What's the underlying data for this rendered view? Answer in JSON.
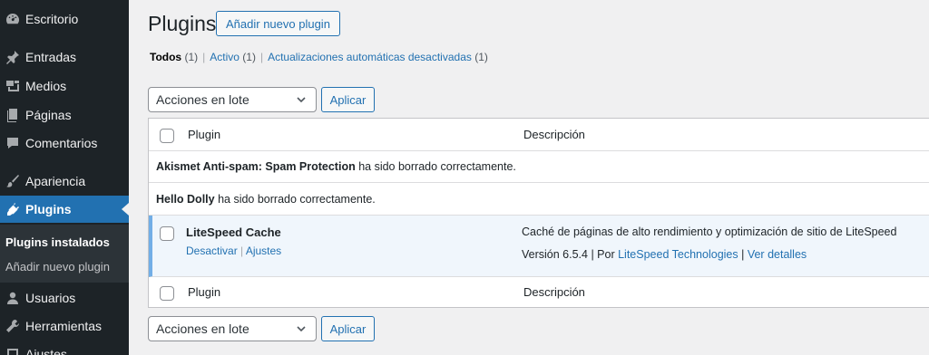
{
  "sidebar": {
    "items": [
      {
        "label": "Escritorio",
        "icon": "dashboard-icon"
      },
      {
        "label": "Entradas",
        "icon": "pin-icon"
      },
      {
        "label": "Medios",
        "icon": "media-icon"
      },
      {
        "label": "Páginas",
        "icon": "pages-icon"
      },
      {
        "label": "Comentarios",
        "icon": "comment-icon"
      },
      {
        "label": "Apariencia",
        "icon": "brush-icon"
      },
      {
        "label": "Plugins",
        "icon": "plugin-icon"
      },
      {
        "label": "Usuarios",
        "icon": "user-icon"
      },
      {
        "label": "Herramientas",
        "icon": "wrench-icon"
      },
      {
        "label": "Ajustes",
        "icon": "settings-icon"
      }
    ],
    "submenu": [
      "Plugins instalados",
      "Añadir nuevo plugin"
    ]
  },
  "header": {
    "title": "Plugins",
    "add_new_label": "Añadir nuevo plugin"
  },
  "views": {
    "all_label": "Todos",
    "all_count": "(1)",
    "active_label": "Activo",
    "active_count": "(1)",
    "auto_label": "Actualizaciones automáticas desactivadas",
    "auto_count": "(1)",
    "separator": "|"
  },
  "bulk_actions": {
    "selected": "Acciones en lote",
    "apply_label": "Aplicar"
  },
  "table": {
    "col_plugin": "Plugin",
    "col_description": "Descripción",
    "messages": [
      {
        "name": "Akismet Anti-spam: Spam Protection",
        "text": " ha sido borrado correctamente."
      },
      {
        "name": "Hello Dolly",
        "text": " ha sido borrado correctamente."
      }
    ],
    "plugin": {
      "name": "LiteSpeed Cache",
      "deactivate": "Desactivar",
      "settings": "Ajustes",
      "description": "Caché de páginas de alto rendimiento y optimización de sitio de LiteSpeed",
      "version": "Versión 6.5.4",
      "by": "Por",
      "author": "LiteSpeed Technologies",
      "details": "Ver detalles"
    }
  },
  "colors": {
    "sidebar_bg": "#1d2327",
    "active_bg": "#2271b1",
    "link": "#2271b1",
    "active_row_bg": "#f0f6fc",
    "active_row_border": "#72aee6"
  }
}
